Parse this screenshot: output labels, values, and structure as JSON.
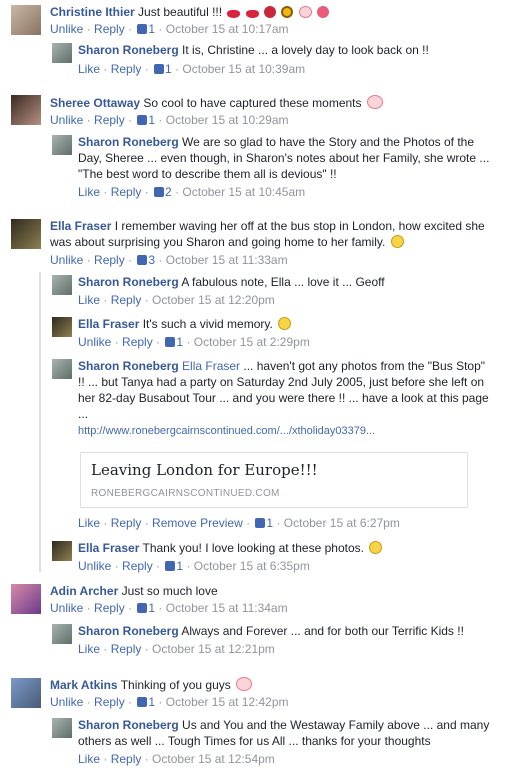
{
  "comments": [
    {
      "name": "Christine Ithier",
      "text": "Just beautiful !!!",
      "emoji_icons": [
        "lips-icon",
        "lips-icon",
        "rose-icon",
        "sunflower-icon",
        "heart-icon",
        "bouquet-icon"
      ],
      "action1": "Unlike",
      "action2": "Reply",
      "likes": "1",
      "time": "October 15 at 10:17am",
      "replies": [
        {
          "name": "Sharon Roneberg",
          "text": "It is, Christine ... a lovely day to look back on !!",
          "action1": "Like",
          "action2": "Reply",
          "likes": "1",
          "time": "October 15 at 10:39am"
        }
      ]
    },
    {
      "name": "Sheree Ottaway",
      "text": "So cool to have captured these moments",
      "emoji_icons": [
        "heart-icon"
      ],
      "action1": "Unlike",
      "action2": "Reply",
      "likes": "1",
      "time": "October 15 at 10:29am",
      "replies": [
        {
          "name": "Sharon Roneberg",
          "text": "We are so glad to have the Story and the Photos of the Day, Sheree ... even though, in Sharon's notes about her Family, she wrote ... \"The best word to describe them all is devious\" !!",
          "action1": "Like",
          "action2": "Reply",
          "likes": "2",
          "time": "October 15 at 10:45am"
        }
      ]
    },
    {
      "name": "Ella Fraser",
      "text": "I remember waving her off at the bus stop in London, how excited she was about surprising you Sharon and going home to her family.",
      "emoji_icons": [
        "smile-icon"
      ],
      "action1": "Unlike",
      "action2": "Reply",
      "likes": "3",
      "time": "October 15 at 11:33am",
      "replies": [
        {
          "name": "Sharon Roneberg",
          "text": "A fabulous note, Ella ... love it ... Geoff",
          "action1": "Like",
          "action2": "Reply",
          "time": "October 15 at 12:20pm"
        },
        {
          "name": "Ella Fraser",
          "text": "It's such a vivid memory.",
          "emoji": "smile-icon",
          "action1": "Unlike",
          "action2": "Reply",
          "likes": "1",
          "time": "October 15 at 2:29pm"
        },
        {
          "name": "Sharon Roneberg",
          "mention": "Ella Fraser",
          "text": "... haven't got any photos from the \"Bus Stop\" !! ... but Tanya had a party on Saturday 2nd July 2005, just before she left on her 82-day Busabout Tour ... and you were there !! ... have a look at this page ...",
          "url": "http://www.ronebergcairnscontinued.com/.../xtholiday03379...",
          "preview_title": "Leaving London for Europe!!!",
          "preview_domain": "RONEBERGCAIRNSCONTINUED.COM",
          "action1": "Like",
          "action2": "Reply",
          "action3": "Remove Preview",
          "likes": "1",
          "time": "October 15 at 6:27pm"
        },
        {
          "name": "Ella Fraser",
          "text": "Thank you! I love looking at these photos.",
          "emoji": "smile-icon",
          "action1": "Unlike",
          "action2": "Reply",
          "likes": "1",
          "time": "October 15 at 6:35pm"
        }
      ]
    },
    {
      "name": "Adin Archer",
      "text": "Just so much love",
      "action1": "Unlike",
      "action2": "Reply",
      "likes": "1",
      "time": "October 15 at 11:34am",
      "replies": [
        {
          "name": "Sharon Roneberg",
          "text": "Always and Forever ... and for both our Terrific Kids !!",
          "action1": "Like",
          "action2": "Reply",
          "time": "October 15 at 12:21pm"
        }
      ]
    },
    {
      "name": "Mark Atkins",
      "text": "Thinking of you guys",
      "emoji_icons": [
        "heart-icon"
      ],
      "action1": "Unlike",
      "action2": "Reply",
      "likes": "1",
      "time": "October 15 at 12:42pm",
      "replies": [
        {
          "name": "Sharon Roneberg",
          "text": "Us and You and the Westaway Family above ... and many others as well ... Tough Times for us All ... thanks for your thoughts",
          "action1": "Like",
          "action2": "Reply",
          "time": "October 15 at 12:54pm"
        }
      ]
    }
  ],
  "colors": {
    "name": "#365899",
    "link": "#4267b2",
    "meta": "#90949c",
    "heart": "#f4a4b4",
    "smile": "#f5d547"
  }
}
